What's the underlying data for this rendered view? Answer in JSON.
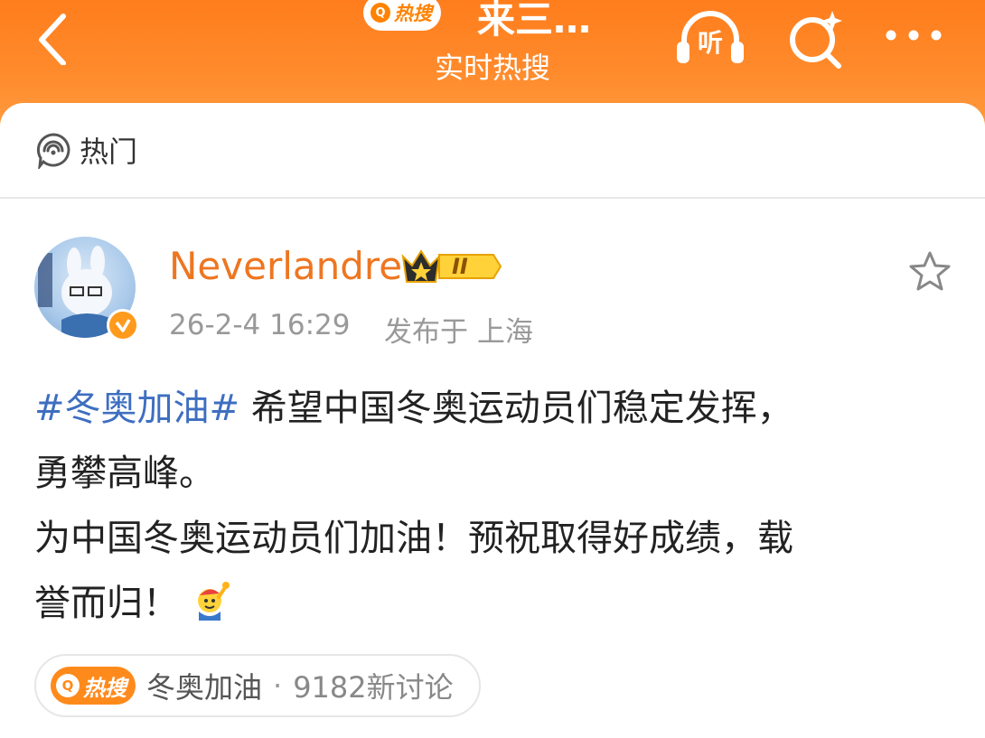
{
  "header": {
    "back_icon": "chevron-left-icon",
    "hot_badge": {
      "q": "Q",
      "text": "热搜"
    },
    "title": "来三…",
    "subtitle": "实时热搜",
    "listen_label": "听",
    "search_icon": "search-sparkle-icon",
    "more_icon": "more-dots-icon",
    "color": "#ff8200"
  },
  "tab": {
    "label": "热门",
    "icon": "hot-chat-icon"
  },
  "post": {
    "username": "Neverlandre",
    "member_level": "II",
    "time": "26-2-4 16:29",
    "from": "发布于 上海",
    "hashtag": "#冬奥加油#",
    "line1": " 希望中国冬奥运动员们稳定发挥，",
    "line2": "勇攀高峰。",
    "line3": "为中国冬奥运动员们加油！预祝取得好成绩，载",
    "line4": "誉而归！",
    "emoji": "cheer-emoji",
    "username_color": "#ee7621",
    "hashtag_color": "#3e6ec0"
  },
  "topic": {
    "tag_q": "Q",
    "tag_text": "热搜",
    "name": "冬奥加油",
    "separator": "·",
    "count": "9182新讨论"
  }
}
